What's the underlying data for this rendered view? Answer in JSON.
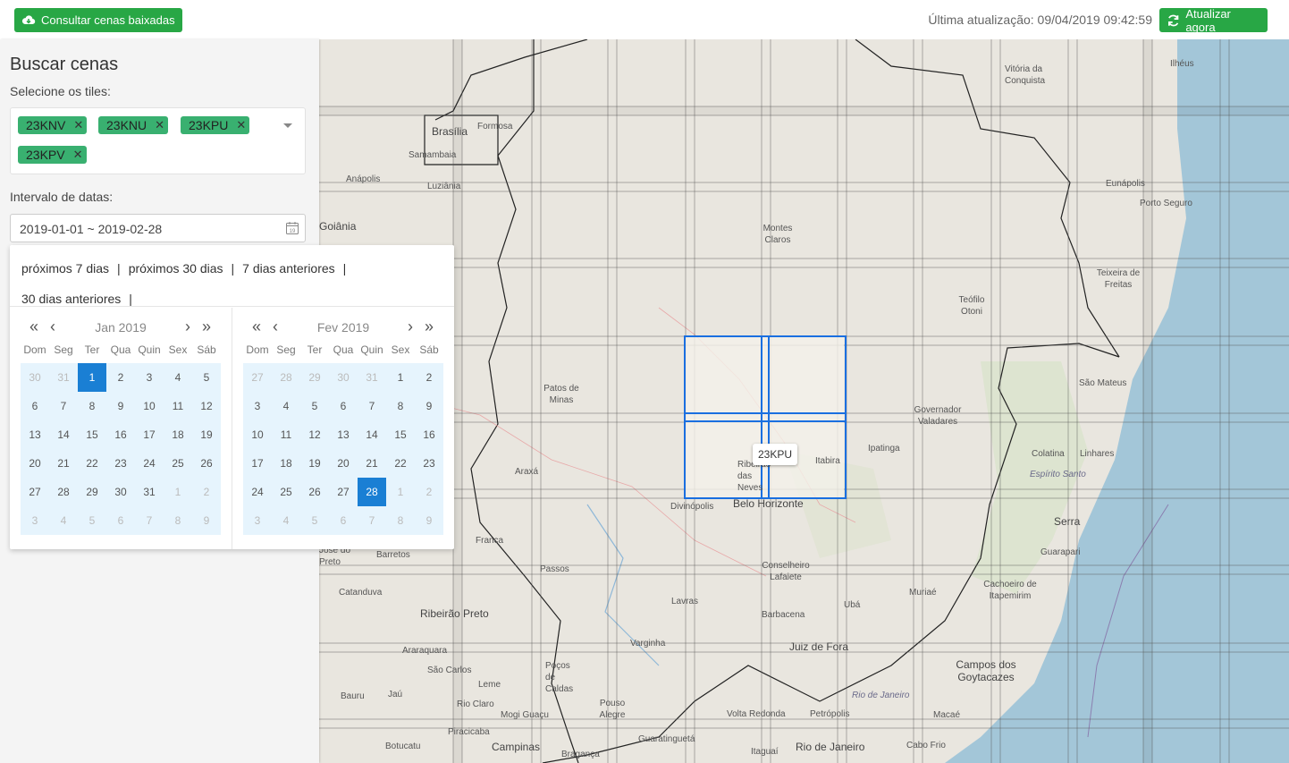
{
  "topbar": {
    "downloaded_label": "Consultar cenas baixadas",
    "last_update": "Última atualização: 09/04/2019 09:42:59",
    "refresh_label": "Atualizar agora"
  },
  "sidebar": {
    "title": "Buscar cenas",
    "tiles_label": "Selecione os tiles:",
    "tiles": [
      "23KNV",
      "23KNU",
      "23KPU",
      "23KPV"
    ],
    "date_label": "Intervalo de datas:",
    "date_value": "2019-01-01 ~ 2019-02-28"
  },
  "datepicker": {
    "presets": [
      "próximos 7 dias",
      "próximos 30 dias",
      "7 dias anteriores",
      "30 dias anteriores"
    ],
    "weekdays": [
      "Dom",
      "Seg",
      "Ter",
      "Qua",
      "Quin",
      "Sex",
      "Sáb"
    ],
    "calendars": [
      {
        "month": "Jan 2019",
        "days": [
          "30",
          "31",
          "1",
          "2",
          "3",
          "4",
          "5",
          "6",
          "7",
          "8",
          "9",
          "10",
          "11",
          "12",
          "13",
          "14",
          "15",
          "16",
          "17",
          "18",
          "19",
          "20",
          "21",
          "22",
          "23",
          "24",
          "25",
          "26",
          "27",
          "28",
          "29",
          "30",
          "31",
          "1",
          "2",
          "3",
          "4",
          "5",
          "6",
          "7",
          "8",
          "9"
        ],
        "first_in_month": 2,
        "last_in_month": 32,
        "selected": "1"
      },
      {
        "month": "Fev 2019",
        "days": [
          "27",
          "28",
          "29",
          "30",
          "31",
          "1",
          "2",
          "3",
          "4",
          "5",
          "6",
          "7",
          "8",
          "9",
          "10",
          "11",
          "12",
          "13",
          "14",
          "15",
          "16",
          "17",
          "18",
          "19",
          "20",
          "21",
          "22",
          "23",
          "24",
          "25",
          "26",
          "27",
          "28",
          "1",
          "2",
          "3",
          "4",
          "5",
          "6",
          "7",
          "8",
          "9"
        ],
        "first_in_month": 5,
        "last_in_month": 32,
        "selected": "28"
      }
    ]
  },
  "map": {
    "tooltip": "23KPU",
    "labels": [
      "Brasília",
      "Formosa",
      "Samambaia",
      "Anápolis",
      "Luziânia",
      "Goiânia",
      "Vitória da Conquista",
      "Ilhéus",
      "Eunápolis",
      "Porto Seguro",
      "Montes Claros",
      "Teixeira de Freitas",
      "Teófilo Otoni",
      "São Mateus",
      "Patos de Minas",
      "Governador Valadares",
      "Ipatinga",
      "Itabira",
      "Ribeirão das Neves",
      "Colatina",
      "Linhares",
      "Espírito Santo",
      "Araxá",
      "Divinópolis",
      "Belo Horizonte",
      "Serra",
      "Guarapari",
      "Franca",
      "Barretos",
      "Passos",
      "Conselheiro Lafaiete",
      "Muriaé",
      "Cachoeiro de Itapemirim",
      "Catanduva",
      "Ribeirão Preto",
      "Lavras",
      "Barbacena",
      "Ubá",
      "Varginha",
      "Juiz de Fora",
      "Araraquara",
      "São Carlos",
      "Poços de Caldas",
      "Leme",
      "Campos dos Goytacazes",
      "Bauru",
      "Jaú",
      "Rio Claro",
      "Pouso Alegre",
      "Rio de Janeiro",
      "Mogi Guaçu",
      "Volta Redonda",
      "Petrópolis",
      "Macaé",
      "Piracicaba",
      "Guaratinguetá",
      "Botucatu",
      "Campinas",
      "Bragança",
      "Itaguaí",
      "Rio de Janeiro",
      "Cabo Frio",
      "José do Preto"
    ]
  },
  "colors": {
    "accent_green": "#28a745",
    "selected_blue": "#1a7fd4",
    "range_bg": "#e6f4fd",
    "ocean": "#a3c6d8"
  }
}
